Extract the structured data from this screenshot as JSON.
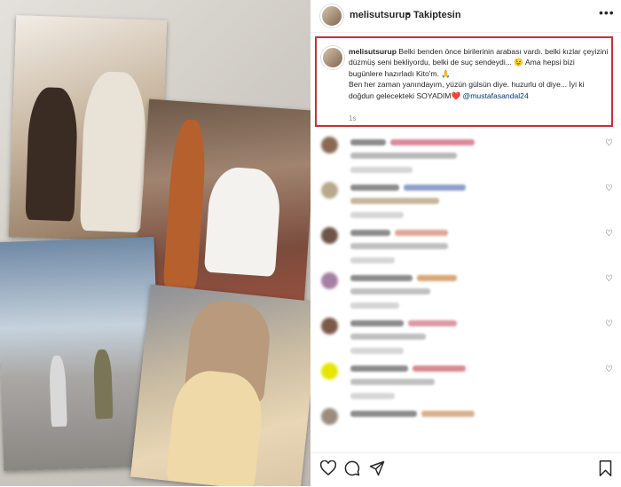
{
  "post": {
    "username": "melisutsurup",
    "dot": "•",
    "follow_status": "Takiptesin",
    "more": "•••"
  },
  "caption": {
    "username": "melisutsurup",
    "text": "Belki benden önce birilerinin arabası vardı. belki kızlar çeyizini düzmüş seni bekliyordu, belki de suç sendeydi... 😉 Ama hepsi bizi bugünlere hazırladı Kito'm. 🙏",
    "text2": "Ben her zaman yanındayım, yüzün gülsün diye. huzurlu ol diye... İyi ki doğdun gelecekteki SOYADIM",
    "heart": "❤️",
    "mention": "@mustafasandal24",
    "time": "1s"
  },
  "icons": {
    "like": "heart-outline-icon",
    "comment": "comment-bubble-icon",
    "share": "paper-plane-icon",
    "save": "bookmark-icon",
    "comment_like": "small-heart-icon"
  },
  "colors": {
    "highlight_border": "#c62f3d",
    "mention": "#00376b",
    "secondary_text": "#8e8e8e"
  }
}
